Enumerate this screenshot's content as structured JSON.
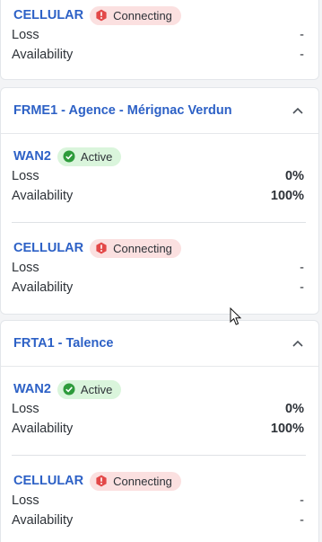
{
  "top_fragment": {
    "link": {
      "name": "CELLULAR",
      "status": "Connecting",
      "loss_label": "Loss",
      "loss_value": "-",
      "availability_label": "Availability",
      "availability_value": "-"
    }
  },
  "sites": [
    {
      "title": "FRME1 - Agence - Mérignac Verdun",
      "links": [
        {
          "name": "WAN2",
          "status": "Active",
          "loss_label": "Loss",
          "loss_value": "0%",
          "availability_label": "Availability",
          "availability_value": "100%"
        },
        {
          "name": "CELLULAR",
          "status": "Connecting",
          "loss_label": "Loss",
          "loss_value": "-",
          "availability_label": "Availability",
          "availability_value": "-"
        }
      ]
    },
    {
      "title": "FRTA1 - Talence",
      "links": [
        {
          "name": "WAN2",
          "status": "Active",
          "loss_label": "Loss",
          "loss_value": "0%",
          "availability_label": "Availability",
          "availability_value": "100%"
        },
        {
          "name": "CELLULAR",
          "status": "Connecting",
          "loss_label": "Loss",
          "loss_value": "-",
          "availability_label": "Availability",
          "availability_value": "-"
        }
      ]
    }
  ],
  "icons": {
    "collapse": "chevron-up-icon",
    "active": "check-circle-icon",
    "connecting": "alert-circle-icon"
  },
  "colors": {
    "link_blue": "#2d61c6",
    "active_bg": "#daf5dc",
    "active_icon": "#2e9b3b",
    "connecting_bg": "#fbe0e0",
    "connecting_icon": "#e34848"
  }
}
